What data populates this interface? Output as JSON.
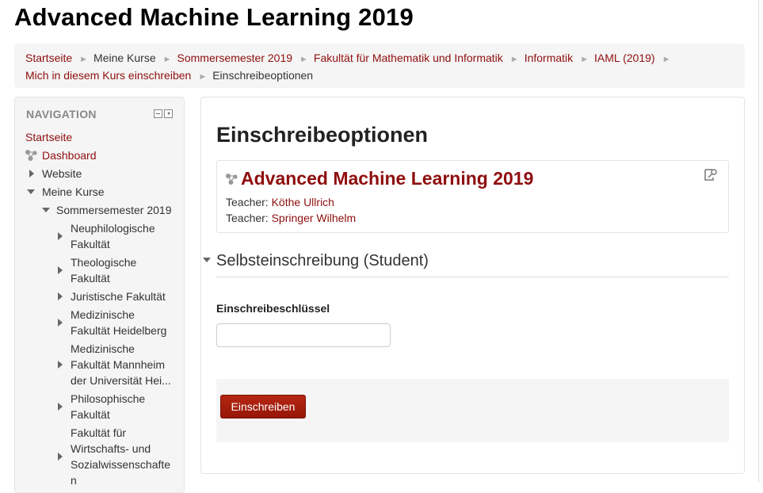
{
  "page": {
    "title": "Advanced Machine Learning 2019"
  },
  "breadcrumb": {
    "items": [
      "Startseite",
      "Meine Kurse",
      "Sommersemester 2019",
      "Fakultät für Mathematik und Informatik",
      "Informatik",
      "IAML (2019)",
      "Mich in diesem Kurs einschreiben",
      "Einschreibeoptionen"
    ],
    "separator": "►"
  },
  "navigation": {
    "header": "NAVIGATION",
    "items": [
      "Startseite",
      "Dashboard",
      "Website",
      "Meine Kurse",
      "Sommersemester 2019",
      [
        "Neuphilologische",
        "Fakultät"
      ],
      [
        "Theologische",
        "Fakultät"
      ],
      "Juristische Fakultät",
      [
        "Medizinische",
        "Fakultät Heidelberg"
      ],
      [
        "Medizinische",
        "Fakultät Mannheim",
        "der Universität Hei..."
      ],
      [
        "Philosophische",
        "Fakultät"
      ],
      [
        "Fakultät für",
        "Wirtschafts- und",
        "Sozialwissenschafte",
        "n"
      ]
    ]
  },
  "main": {
    "heading": "Einschreibeoptionen",
    "course": {
      "title": "Advanced Machine Learning 2019",
      "teachers": [
        {
          "label": "Teacher: ",
          "name": "Köthe Ullrich"
        },
        {
          "label": "Teacher: ",
          "name": "Springer Wilhelm"
        }
      ]
    },
    "section_title": "Selbsteinschreibung (Student)",
    "field_label": "Einschreibeschlüssel",
    "field_value": "",
    "submit_label": "Einschreiben"
  },
  "colors": {
    "link": "#8f0e0e",
    "button": "#a51c08",
    "panel": "#f5f5f5"
  },
  "icons": [
    "hub-icon",
    "edit-key-icon",
    "expand-icon",
    "collapse-icon",
    "dock-icon",
    "minimize-icon"
  ]
}
